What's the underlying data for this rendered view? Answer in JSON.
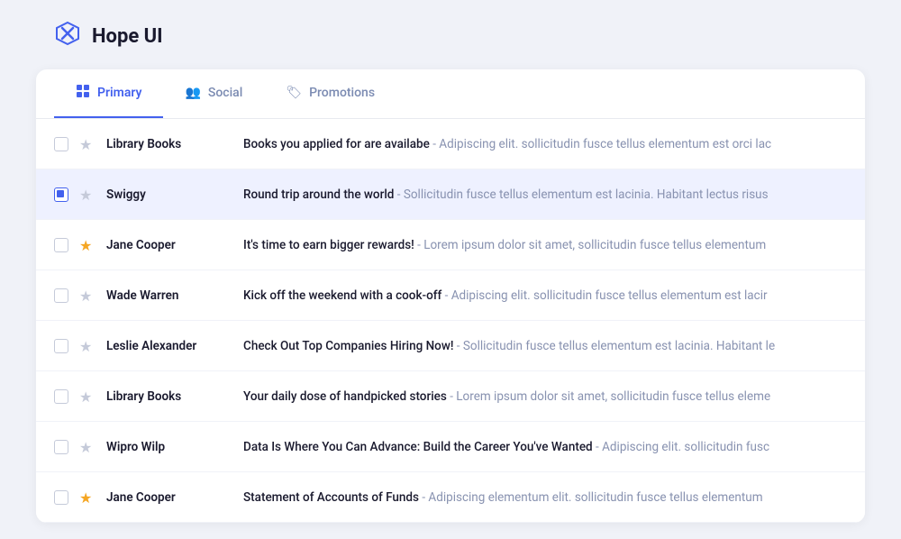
{
  "app": {
    "title": "Hope UI",
    "logo_symbol": "✕"
  },
  "tabs": [
    {
      "id": "primary",
      "label": "Primary",
      "icon": "🔵",
      "active": true
    },
    {
      "id": "social",
      "label": "Social",
      "icon": "👥",
      "active": false
    },
    {
      "id": "promotions",
      "label": "Promotions",
      "icon": "🏷",
      "active": false
    }
  ],
  "emails": [
    {
      "id": 1,
      "checked": false,
      "starred": false,
      "highlighted": false,
      "sender": "Library Books",
      "subject": "Books you applied for are availabe",
      "preview": "- Adipiscing elit.  sollicitudin fusce tellus elementum est orci lac"
    },
    {
      "id": 2,
      "checked": true,
      "starred": false,
      "highlighted": true,
      "sender": "Swiggy",
      "subject": "Round trip around the world",
      "preview": "- Sollicitudin fusce tellus elementum est lacinia. Habitant lectus risus"
    },
    {
      "id": 3,
      "checked": false,
      "starred": true,
      "highlighted": false,
      "sender": "Jane Cooper",
      "subject": "It's time to earn bigger rewards!",
      "preview": "- Lorem ipsum dolor sit amet,  sollicitudin fusce tellus elementum"
    },
    {
      "id": 4,
      "checked": false,
      "starred": false,
      "highlighted": false,
      "sender": "Wade Warren",
      "subject": "Kick off the weekend with a cook-off",
      "preview": "- Adipiscing elit.  sollicitudin fusce tellus elementum est lacir"
    },
    {
      "id": 5,
      "checked": false,
      "starred": false,
      "highlighted": false,
      "sender": "Leslie Alexander",
      "subject": "Check Out Top Companies Hiring Now!",
      "preview": "- Sollicitudin fusce tellus elementum est lacinia. Habitant le"
    },
    {
      "id": 6,
      "checked": false,
      "starred": false,
      "highlighted": false,
      "sender": "Library Books",
      "subject": "Your daily dose of handpicked stories",
      "preview": "- Lorem ipsum dolor sit amet,  sollicitudin fusce tellus eleme"
    },
    {
      "id": 7,
      "checked": false,
      "starred": false,
      "highlighted": false,
      "sender": "Wipro Wilp",
      "subject": "Data Is Where You Can Advance: Build the Career You've Wanted",
      "preview": "- Adipiscing elit.  sollicitudin fusc"
    },
    {
      "id": 8,
      "checked": false,
      "starred": true,
      "highlighted": false,
      "sender": "Jane Cooper",
      "subject": "Statement of Accounts of Funds",
      "preview": "- Adipiscing elementum elit. sollicitudin fusce tellus elementum"
    }
  ]
}
